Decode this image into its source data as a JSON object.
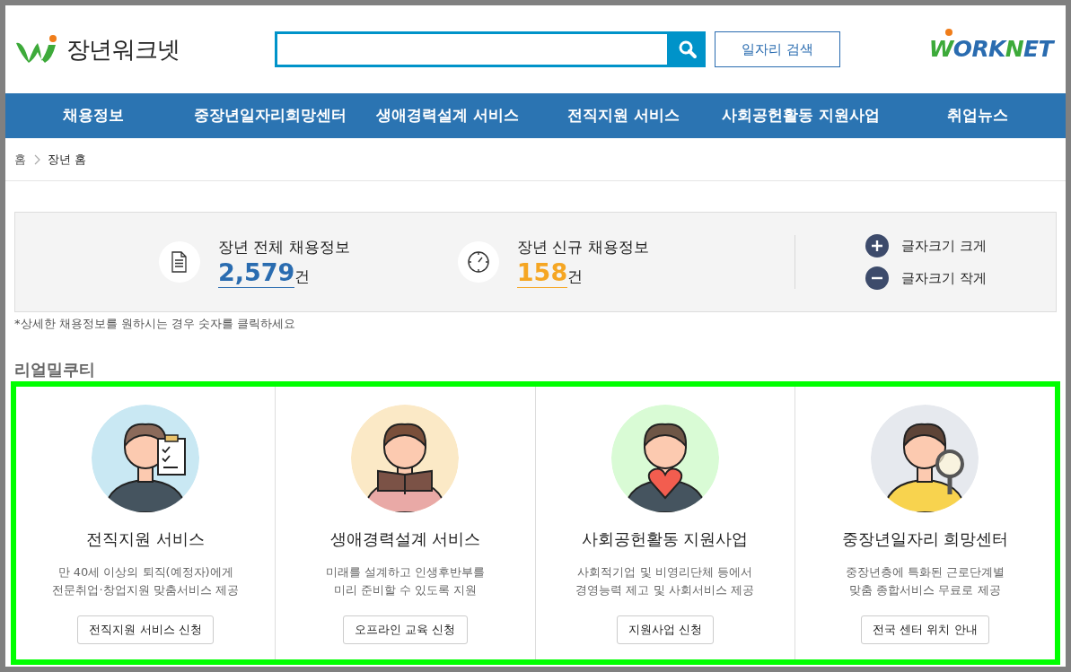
{
  "header": {
    "site_name": "장년워크넷",
    "search_button": "일자리 검색",
    "partner_logo": "WORKNET"
  },
  "nav": [
    "채용정보",
    "중장년일자리희망센터",
    "생애경력설계 서비스",
    "전직지원 서비스",
    "사회공헌활동 지원사업",
    "취업뉴스"
  ],
  "breadcrumb": [
    "홈",
    "장년 홈"
  ],
  "stats": [
    {
      "kind": "document",
      "label": "장년 전체 채용정보",
      "count": "2,579",
      "unit": "건",
      "color": "#2a6cb0"
    },
    {
      "kind": "clock",
      "label": "장년 신규 채용정보",
      "count": "158",
      "unit": "건",
      "color": "#f5a623"
    }
  ],
  "font_size": [
    {
      "kind": "plus",
      "label": "글자크기 크게"
    },
    {
      "kind": "minus",
      "label": "글자크기 작게"
    }
  ],
  "note": "*상세한 채용정보를 원하시는 경우 숫자를 클릭하세요",
  "section_title": "리얼밀쿠티",
  "cards": [
    {
      "kind": "clipboard",
      "color": "#c9e8f3",
      "title": "전직지원 서비스",
      "description": [
        "만 40세 이상의 퇴직(예정자)에게",
        "전문취업·창업지원 맞춤서비스 제공"
      ],
      "button": "전직지원 서비스 신청"
    },
    {
      "kind": "book",
      "color": "#fbe9c6",
      "title": "생애경력설계 서비스",
      "description": [
        "미래를 설계하고 인생후반부를",
        "미리 준비할 수 있도록 지원"
      ],
      "button": "오프라인 교육 신청"
    },
    {
      "kind": "heart",
      "color": "#d9fbd5",
      "title": "사회공헌활동 지원사업",
      "description": [
        "사회적기업 및 비영리단체 등에서",
        "경영능력 제고 및 사회서비스 제공"
      ],
      "button": "지원사업 신청"
    },
    {
      "kind": "magnifier",
      "color": "#e6e9ee",
      "title": "중장년일자리 희망센터",
      "description": [
        "중장년층에 특화된 근로단계별",
        "맞춤 종합서비스 무료로 제공"
      ],
      "button": "전국 센터 위치 안내"
    }
  ]
}
